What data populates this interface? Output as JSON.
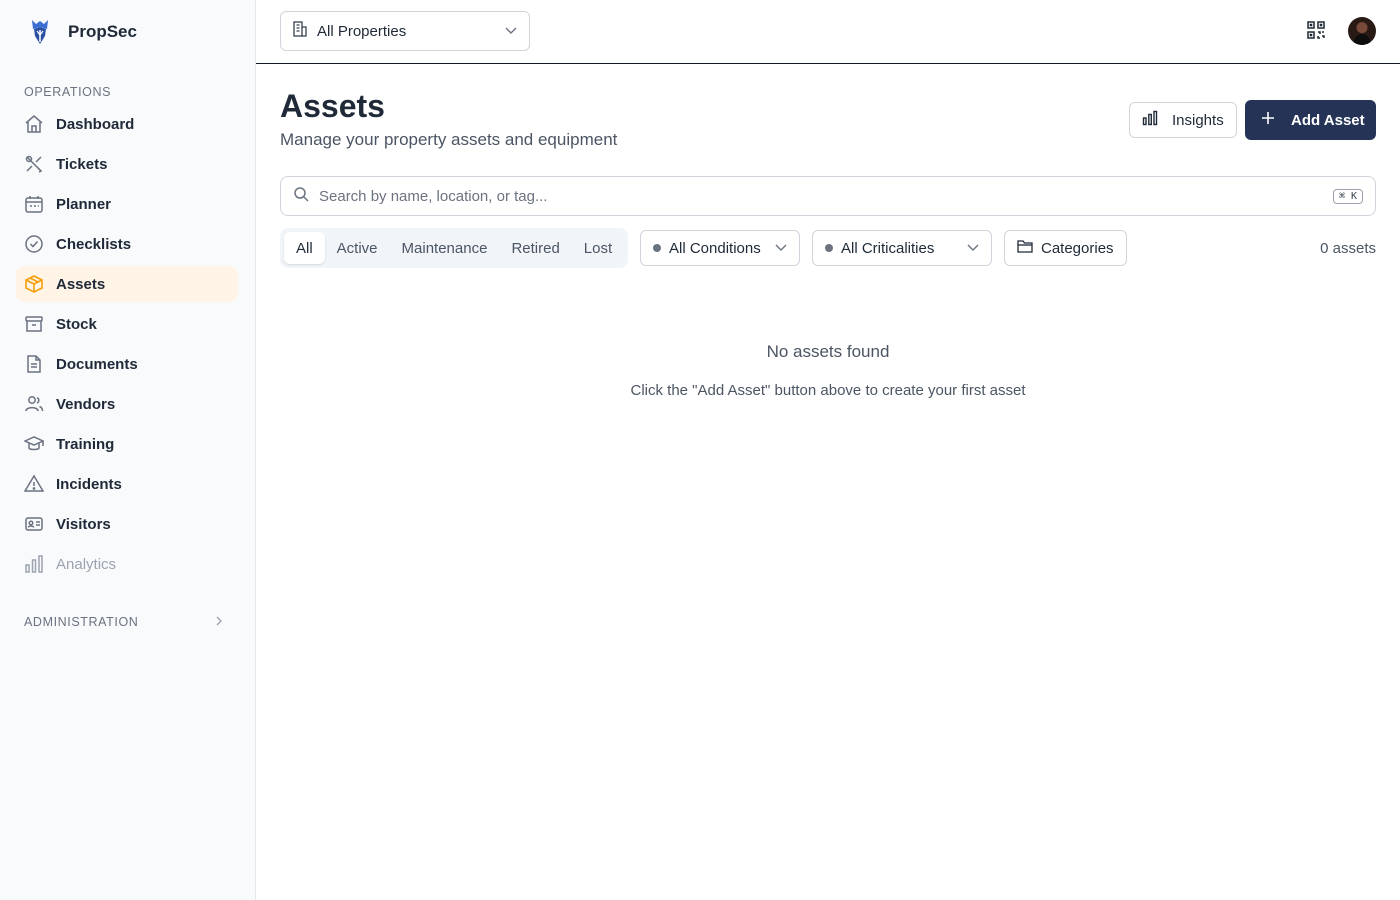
{
  "app": {
    "name": "PropSec",
    "accent": "#f59e0b",
    "brand_color": "#253456"
  },
  "sidebar": {
    "operations_title": "OPERATIONS",
    "items": [
      {
        "label": "Dashboard",
        "icon": "home-icon"
      },
      {
        "label": "Tickets",
        "icon": "tools-icon"
      },
      {
        "label": "Planner",
        "icon": "calendar-icon"
      },
      {
        "label": "Checklists",
        "icon": "check-circle-icon"
      },
      {
        "label": "Assets",
        "icon": "box-icon",
        "active": true
      },
      {
        "label": "Stock",
        "icon": "archive-icon"
      },
      {
        "label": "Documents",
        "icon": "document-icon"
      },
      {
        "label": "Vendors",
        "icon": "users-icon"
      },
      {
        "label": "Training",
        "icon": "graduation-cap-icon"
      },
      {
        "label": "Incidents",
        "icon": "warning-icon"
      },
      {
        "label": "Visitors",
        "icon": "id-card-icon"
      },
      {
        "label": "Analytics",
        "icon": "bar-chart-icon",
        "disabled": true
      }
    ],
    "administration_title": "ADMINISTRATION"
  },
  "topbar": {
    "property_select": "All Properties"
  },
  "page": {
    "title": "Assets",
    "subtitle": "Manage your property assets and equipment",
    "insights_label": "Insights",
    "add_label": "Add Asset"
  },
  "search": {
    "placeholder": "Search by name, location, or tag...",
    "shortcut": "⌘ K"
  },
  "filters": {
    "tabs": [
      "All",
      "Active",
      "Maintenance",
      "Retired",
      "Lost"
    ],
    "selected_tab": "All",
    "conditions": "All Conditions",
    "criticalities": "All Criticalities",
    "categories": "Categories",
    "count": "0 assets"
  },
  "empty": {
    "title": "No assets found",
    "message": "Click the \"Add Asset\" button above to create your first asset"
  }
}
